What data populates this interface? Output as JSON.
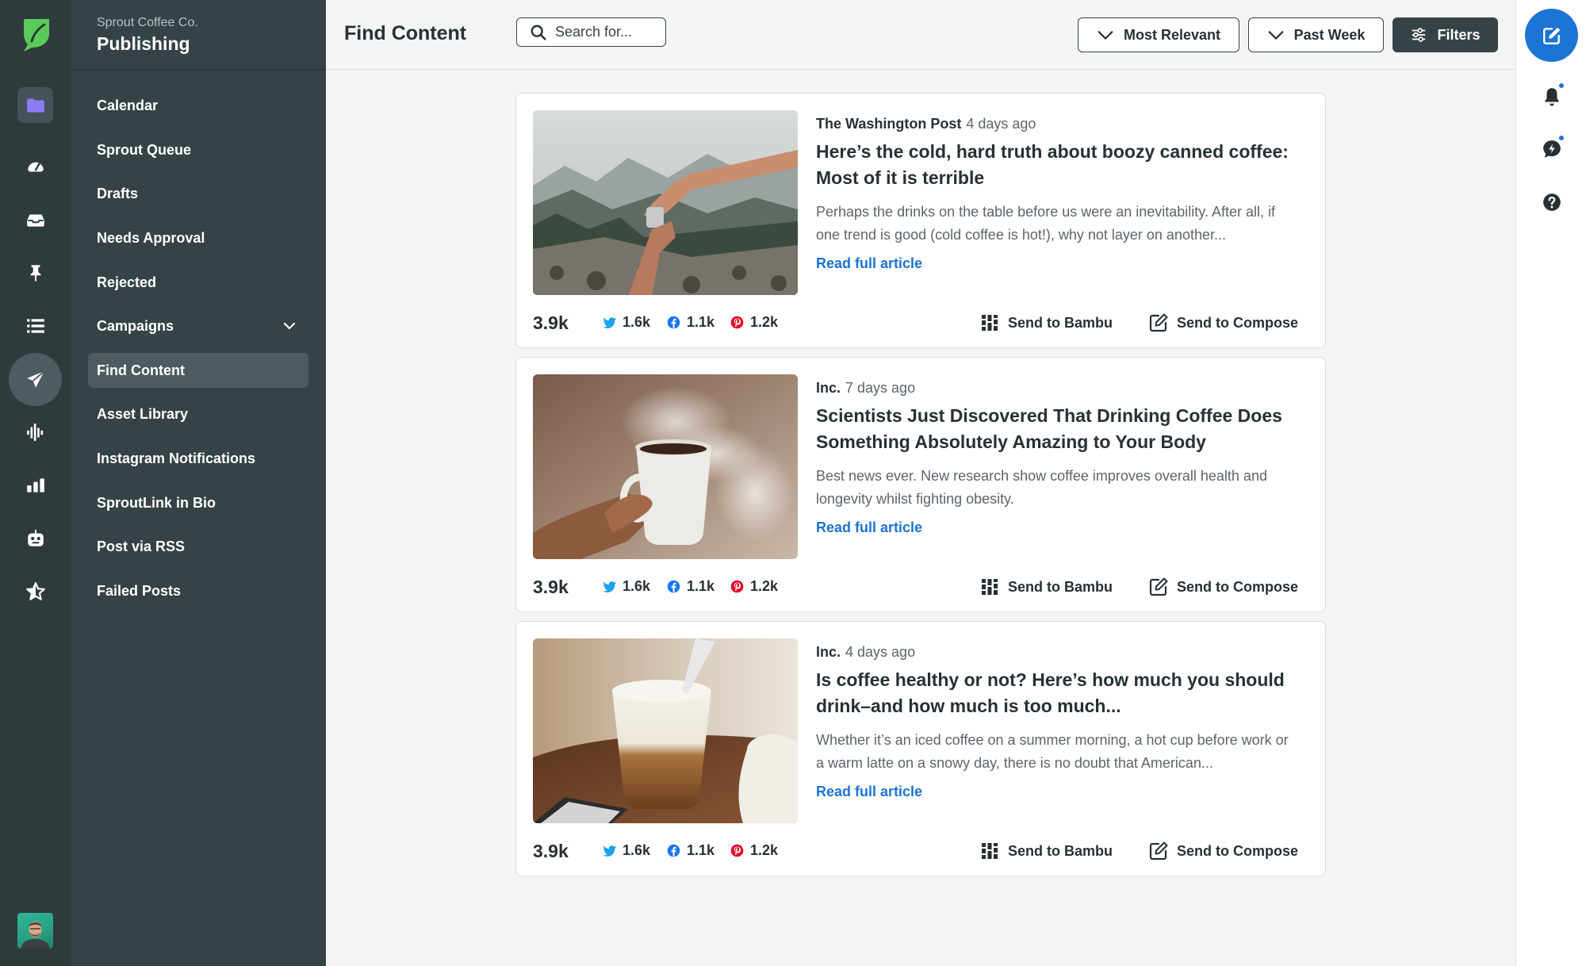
{
  "org_name": "Sprout Coffee Co.",
  "section_name": "Publishing",
  "nav_items": [
    {
      "label": "Calendar"
    },
    {
      "label": "Sprout Queue"
    },
    {
      "label": "Drafts"
    },
    {
      "label": "Needs Approval"
    },
    {
      "label": "Rejected"
    },
    {
      "label": "Campaigns"
    },
    {
      "label": "Find Content"
    },
    {
      "label": "Asset Library"
    },
    {
      "label": "Instagram Notifications"
    },
    {
      "label": "SproutLink in Bio"
    },
    {
      "label": "Post via RSS"
    },
    {
      "label": "Failed Posts"
    }
  ],
  "topbar": {
    "title": "Find Content",
    "search_placeholder": "Search for...",
    "sort_label": "Most Relevant",
    "range_label": "Past Week",
    "filters_label": "Filters"
  },
  "articles": [
    {
      "source": "The Washington Post",
      "age": "4 days ago",
      "headline": "Here’s the cold, hard truth about boozy canned coffee: Most of it is terrible",
      "description": "Perhaps the drinks on the table before us were an inevitability. After all, if one trend is good (cold coffee is hot!), why not layer on another...",
      "read_label": "Read full article",
      "total": "3.9k",
      "twitter": "1.6k",
      "facebook": "1.1k",
      "pinterest": "1.2k",
      "bambu_label": "Send to Bambu",
      "compose_label": "Send to Compose"
    },
    {
      "source": "Inc.",
      "age": "7 days ago",
      "headline": "Scientists Just Discovered That Drinking Coffee Does Something Absolutely Amazing to Your Body",
      "description": "Best news ever. New research show coffee improves overall health and longevity whilst fighting obesity.",
      "read_label": "Read full article",
      "total": "3.9k",
      "twitter": "1.6k",
      "facebook": "1.1k",
      "pinterest": "1.2k",
      "bambu_label": "Send to Bambu",
      "compose_label": "Send to Compose"
    },
    {
      "source": "Inc.",
      "age": "4 days ago",
      "headline": "Is coffee healthy or not? Here’s how much you should drink–and how much is too much...",
      "description": "Whether it’s an iced coffee on a summer morning, a hot cup before work or a warm latte on a snowy day, there is no doubt that American...",
      "read_label": "Read full article",
      "total": "3.9k",
      "twitter": "1.6k",
      "facebook": "1.1k",
      "pinterest": "1.2k",
      "bambu_label": "Send to Bambu",
      "compose_label": "Send to Compose"
    }
  ],
  "colors": {
    "rail": "#2f3a3c",
    "subnav": "#364245",
    "accent_blue": "#1c74d4",
    "twitter": "#1da1f2",
    "facebook": "#1877f2",
    "pinterest": "#e60023",
    "brand_green": "#59cb59"
  },
  "icons": {
    "rail": [
      "sprout-logo-icon",
      "folder-icon",
      "dashboard-icon",
      "inbox-icon",
      "pin-icon",
      "list-icon",
      "send-icon",
      "listening-icon",
      "reports-icon",
      "bot-icon",
      "reviews-icon"
    ],
    "utility": [
      "compose-icon",
      "bell-icon",
      "feedback-icon",
      "help-icon"
    ]
  }
}
